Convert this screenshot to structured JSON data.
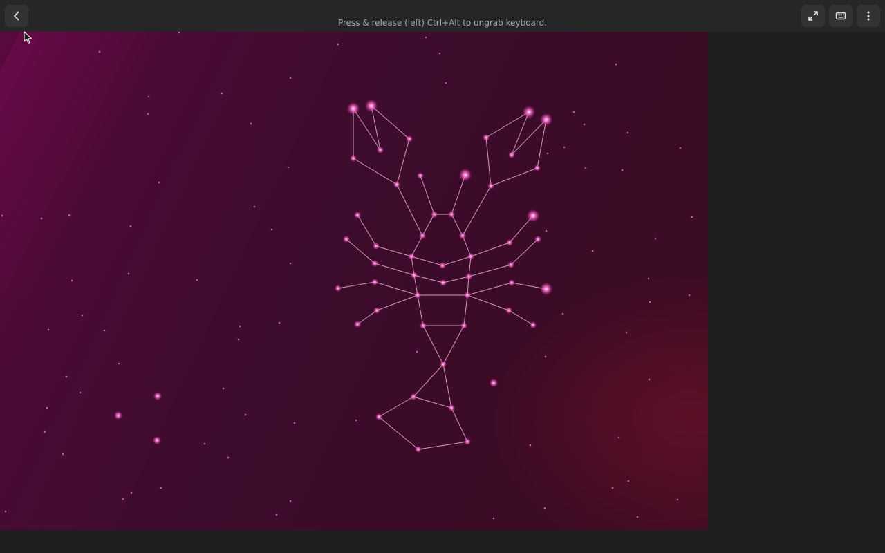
{
  "headerbar": {
    "hint_text": "Press & release (left) Ctrl+Alt to ungrab keyboard.",
    "buttons": {
      "back": {
        "icon": "chevron-left-icon"
      },
      "fullscreen": {
        "icon": "fullscreen-icon"
      },
      "keyboard": {
        "icon": "keyboard-icon"
      },
      "menu": {
        "icon": "kebab-menu-icon"
      }
    }
  },
  "vm_display": {
    "wallpaper": "constellation-lobster",
    "colors": {
      "background": "#3f0c2d",
      "line": "#f2b6d8",
      "star": "#ff5fc8"
    }
  }
}
